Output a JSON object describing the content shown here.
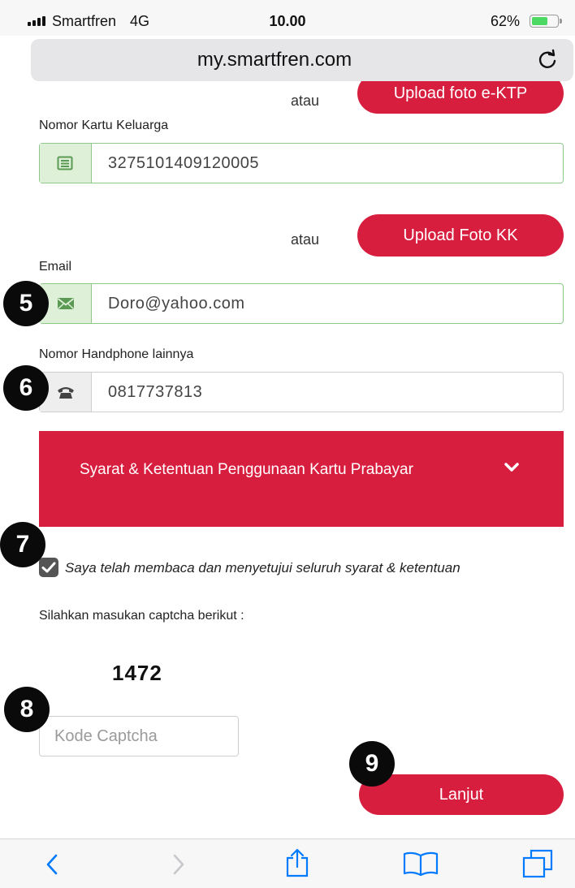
{
  "status_bar": {
    "carrier": "Smartfren",
    "network": "4G",
    "time": "10.00",
    "battery_percent": "62%",
    "battery_level": 0.62
  },
  "browser": {
    "url": "my.smartfren.com",
    "reload_icon": "reload-icon"
  },
  "top_partial": {
    "atau": "atau",
    "upload_ktp_label": "Upload foto e-KTP"
  },
  "kk": {
    "label": "Nomor Kartu Keluarga",
    "value": "3275101409120005",
    "icon": "id-card-icon"
  },
  "kk_upload": {
    "atau": "atau",
    "button_label": "Upload Foto KK"
  },
  "email": {
    "label": "Email",
    "value": "Doro@yahoo.com",
    "icon": "envelope-icon"
  },
  "phone": {
    "label": "Nomor Handphone lainnya",
    "value": "0817737813",
    "icon": "phone-icon"
  },
  "terms": {
    "title": "Syarat & Ketentuan Penggunaan Kartu Prabayar",
    "icon": "chevron-down-icon"
  },
  "agreement": {
    "checked": true,
    "text": "Saya telah membaca dan menyetujui seluruh syarat & ketentuan"
  },
  "captcha": {
    "prompt": "Silahkan masukan captcha berikut :",
    "code": "1472",
    "placeholder": "Kode Captcha"
  },
  "submit": {
    "label": "Lanjut"
  },
  "step_badges": [
    "5",
    "6",
    "7",
    "8",
    "9"
  ],
  "colors": {
    "accent_red": "#d81e3f",
    "success_border": "#8ec98a",
    "success_bg": "#dff0d8",
    "ios_blue": "#007aff"
  },
  "toolbar": {
    "icons": [
      "back-icon",
      "forward-icon",
      "share-icon",
      "bookmarks-icon",
      "tabs-icon"
    ]
  }
}
